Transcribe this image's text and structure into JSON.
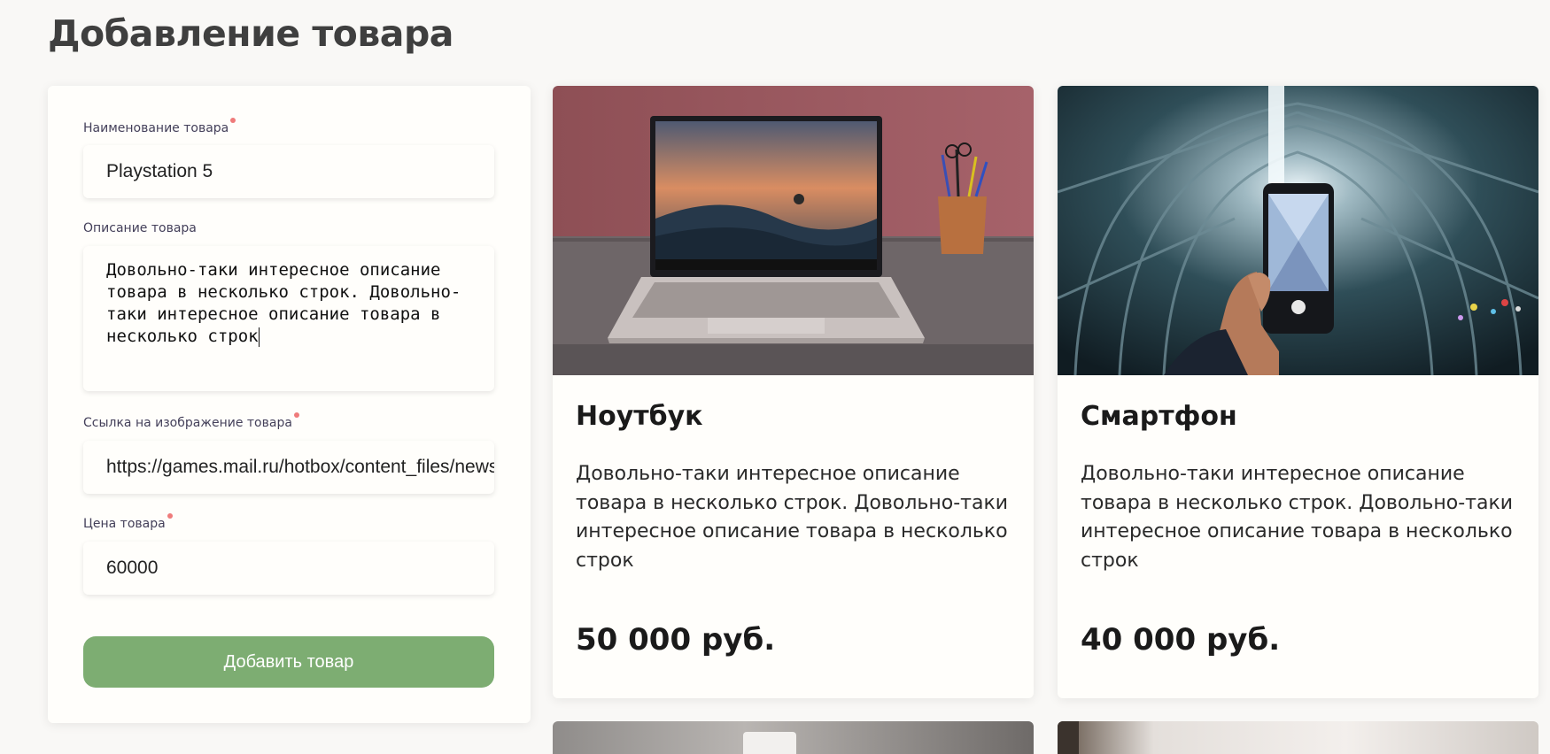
{
  "page": {
    "title": "Добавление товара"
  },
  "form": {
    "name_label": "Наименование товара",
    "name_value": "Playstation 5",
    "description_label": "Описание товара",
    "description_value": "Довольно-таки интересное описание товара в несколько строк. Довольно-таки интересное описание товара в несколько строк",
    "image_label": "Ссылка на изображение товара",
    "image_value": "https://games.mail.ru/hotbox/content_files/news",
    "price_label": "Цена товара",
    "price_value": "60000",
    "submit_label": "Добавить товар",
    "required_color": "#ef7b7b",
    "button_color": "#7dad72"
  },
  "products": [
    {
      "name": "Ноутбук",
      "description": "Довольно-таки интересное описание товара в несколько строк. Довольно-таки интересное описание товара в несколько строк",
      "price": "50 000 руб.",
      "image_icon": "laptop-photo"
    },
    {
      "name": "Смартфон",
      "description": "Довольно-таки интересное описание товара в несколько строк. Довольно-таки интересное описание товара в несколько строк",
      "price": "40 000 руб.",
      "image_icon": "smartphone-photo"
    }
  ]
}
